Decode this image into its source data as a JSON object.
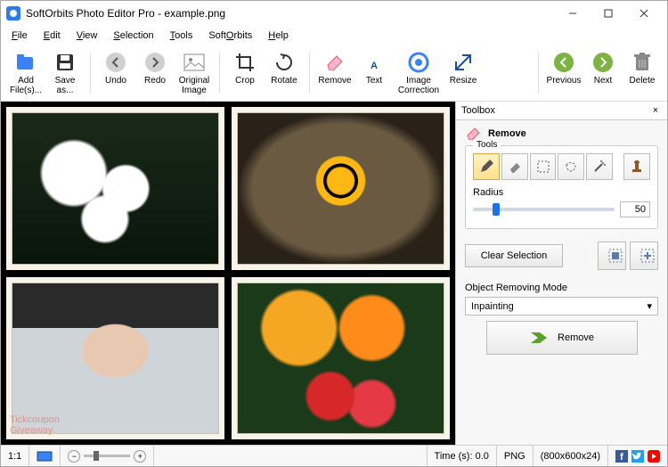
{
  "window": {
    "title": "SoftOrbits Photo Editor Pro - example.png"
  },
  "menu": {
    "file": "File",
    "edit": "Edit",
    "view": "View",
    "selection": "Selection",
    "tools": "Tools",
    "softorbits": "SoftOrbits",
    "help": "Help"
  },
  "toolbar": {
    "add": "Add File(s)...",
    "save": "Save as...",
    "undo": "Undo",
    "redo": "Redo",
    "original": "Original Image",
    "crop": "Crop",
    "rotate": "Rotate",
    "remove": "Remove",
    "text": "Text",
    "imagecorr": "Image Correction",
    "resize": "Resize",
    "prev": "Previous",
    "next": "Next",
    "delete": "Delete"
  },
  "toolbox": {
    "title": "Toolbox",
    "section": "Remove",
    "tools_label": "Tools",
    "radius_label": "Radius",
    "radius_value": "50",
    "clear": "Clear Selection",
    "mode_label": "Object Removing Mode",
    "mode_value": "Inpainting",
    "remove_btn": "Remove"
  },
  "status": {
    "ratio": "1:1",
    "time_label": "Time (s): 0.0",
    "format": "PNG",
    "dims": "(800x600x24)"
  },
  "watermark": {
    "line1": "Tickcoupon",
    "line2": "Giveaway"
  }
}
